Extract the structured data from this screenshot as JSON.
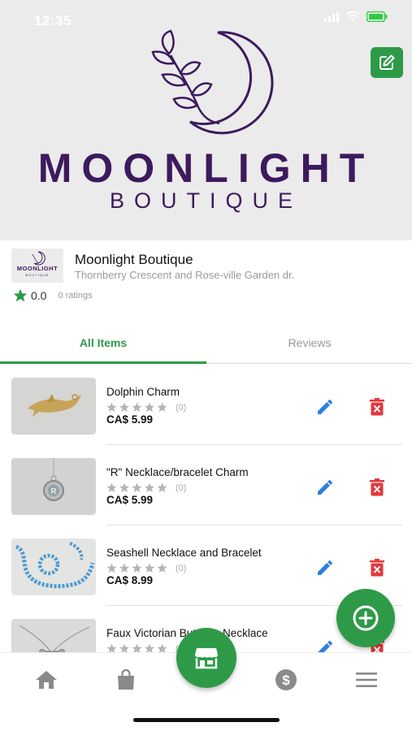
{
  "status_bar": {
    "time": "12:35"
  },
  "banner": {
    "logo_title": "MOONLIGHT",
    "logo_subtitle": "BOUTIQUE",
    "logo_icon": "moon-leaves-logo",
    "edit_icon": "edit-square-icon"
  },
  "store": {
    "thumb_title": "MOONLIGHT",
    "thumb_subtitle": "BOUTIQUE",
    "name": "Moonlight Boutique",
    "address": "Thornberry Crescent and Rose-ville Garden dr.",
    "rating": "0.0",
    "ratings_count": "0 ratings"
  },
  "tabs": [
    {
      "label": "All Items",
      "active": true
    },
    {
      "label": "Reviews",
      "active": false
    }
  ],
  "items": [
    {
      "name": "Dolphin Charm",
      "review_count": "(0)",
      "price": "CA$ 5.99",
      "rating": 0,
      "thumb": "dolphin-charm-photo"
    },
    {
      "name": "\"R\" Necklace/bracelet Charm",
      "review_count": "(0)",
      "price": "CA$ 5.99",
      "rating": 0,
      "thumb": "r-charm-photo"
    },
    {
      "name": "Seashell Necklace and Bracelet",
      "review_count": "(0)",
      "price": "CA$ 8.99",
      "rating": 0,
      "thumb": "seashell-necklace-photo"
    },
    {
      "name": "Faux Victorian Butterfly Necklace",
      "review_count": "(0)",
      "price": "",
      "rating": 0,
      "thumb": "butterfly-necklace-photo"
    }
  ],
  "nav": {
    "items": [
      "home-icon",
      "bag-icon",
      "store-icon",
      "dollar-icon",
      "menu-icon"
    ],
    "active": "store-icon"
  },
  "colors": {
    "accent": "#2e9a48",
    "brand_purple": "#3d1a5e",
    "edit_blue": "#2f7ee0",
    "delete_red": "#e0393e",
    "banner_bg": "#ebebeb"
  }
}
